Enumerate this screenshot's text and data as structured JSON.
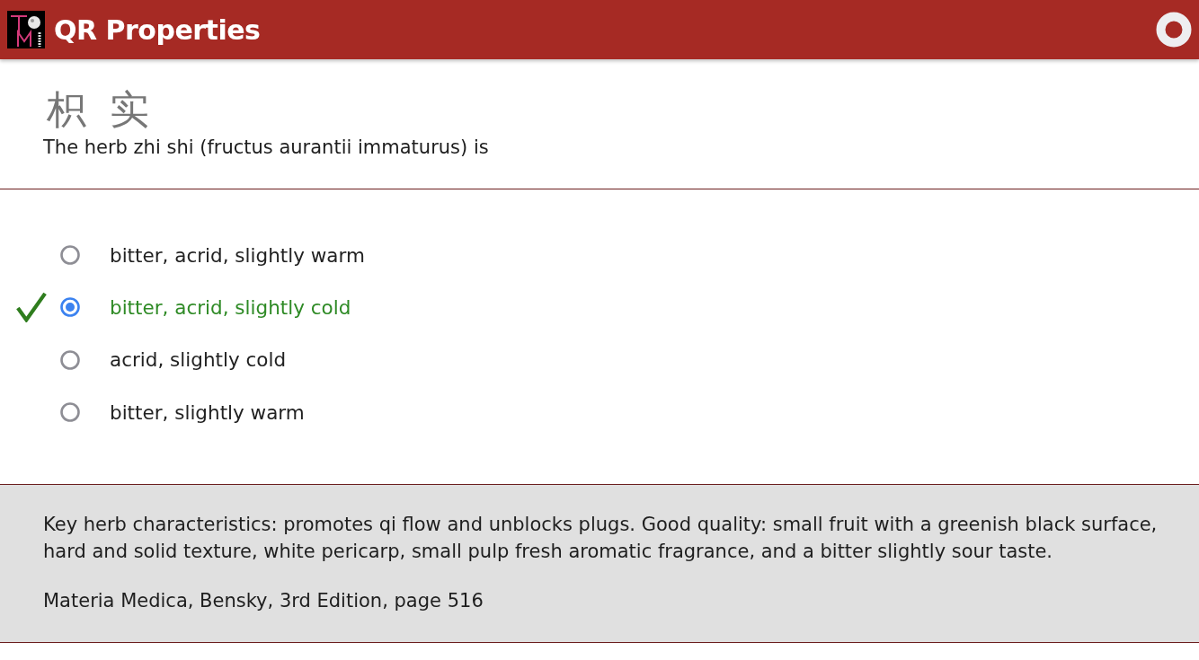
{
  "header": {
    "title": "QR Properties"
  },
  "question": {
    "hanzi": "枳 实",
    "text": "The herb zhi shi (fructus aurantii immaturus) is"
  },
  "options": [
    {
      "label": "bitter, acrid, slightly warm",
      "selected": false,
      "correct": false
    },
    {
      "label": "bitter, acrid, slightly cold",
      "selected": true,
      "correct": true
    },
    {
      "label": "acrid, slightly cold",
      "selected": false,
      "correct": false
    },
    {
      "label": "bitter, slightly warm",
      "selected": false,
      "correct": false
    }
  ],
  "explanation": {
    "text": "Key herb characteristics: promotes qi flow and unblocks plugs. Good quality: small fruit with a greenish black surface, hard and solid texture, white pericarp, small pulp fresh aromatic fragrance, and a bitter slightly sour taste.",
    "source": "Materia Medica, Bensky, 3rd Edition, page 516"
  }
}
